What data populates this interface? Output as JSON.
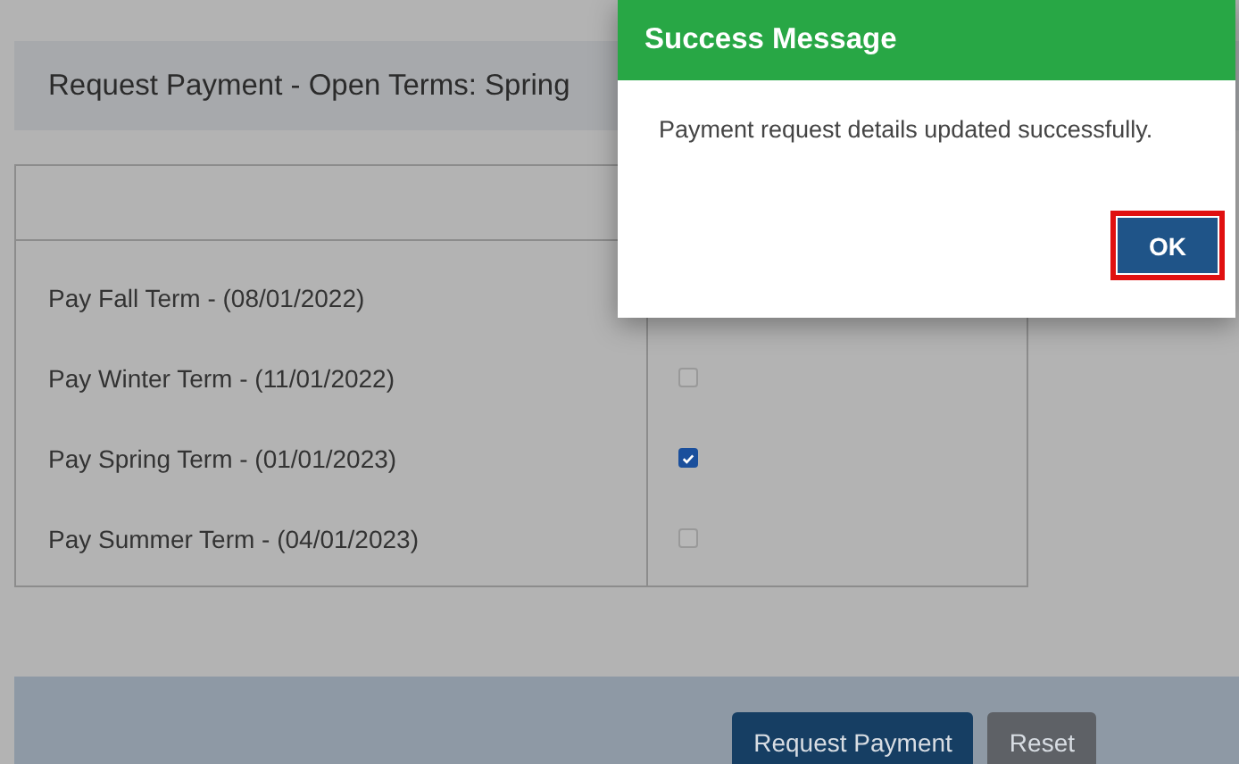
{
  "panel": {
    "title": "Request Payment - Open Terms: Spring"
  },
  "terms": [
    {
      "label": "Pay Fall Term - (08/01/2022)"
    },
    {
      "label": "Pay Winter Term - (11/01/2022)",
      "checked": false
    },
    {
      "label": "Pay Spring Term - (01/01/2023)",
      "checked": true
    },
    {
      "label": "Pay Summer Term - (04/01/2023)",
      "checked": false
    }
  ],
  "buttons": [
    {
      "label": "Request Payment",
      "kind": "primary"
    },
    {
      "label": "Reset",
      "kind": "secondary"
    }
  ],
  "dialog": {
    "title": "Success Message",
    "message": "Payment request details updated successfully.",
    "button": "OK"
  }
}
